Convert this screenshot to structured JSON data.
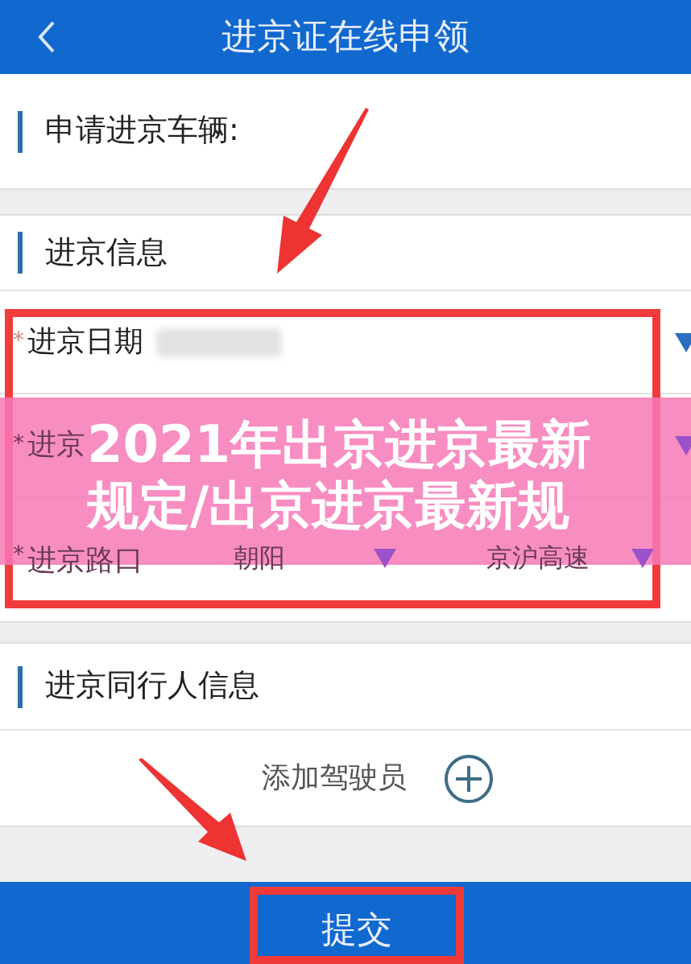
{
  "header": {
    "title": "进京证在线申领"
  },
  "vehicle_section": {
    "label": "申请进京车辆:"
  },
  "entry_info": {
    "heading": "进京信息",
    "rows": [
      {
        "marker": "*",
        "label": "进京日期",
        "kind": "date"
      },
      {
        "marker": "*",
        "label": "进京",
        "kind": "select"
      },
      {
        "marker": "*",
        "label": "进京路口",
        "kind": "double_select",
        "options": [
          "朝阳",
          "京沪高速"
        ]
      }
    ]
  },
  "companions": {
    "heading": "进京同行人信息",
    "add_label": "添加驾驶员"
  },
  "submit": {
    "label": "提交"
  },
  "overlay_banner": {
    "lines": [
      "2021年出京进京最新",
      "规定/出京进京最新规"
    ]
  }
}
